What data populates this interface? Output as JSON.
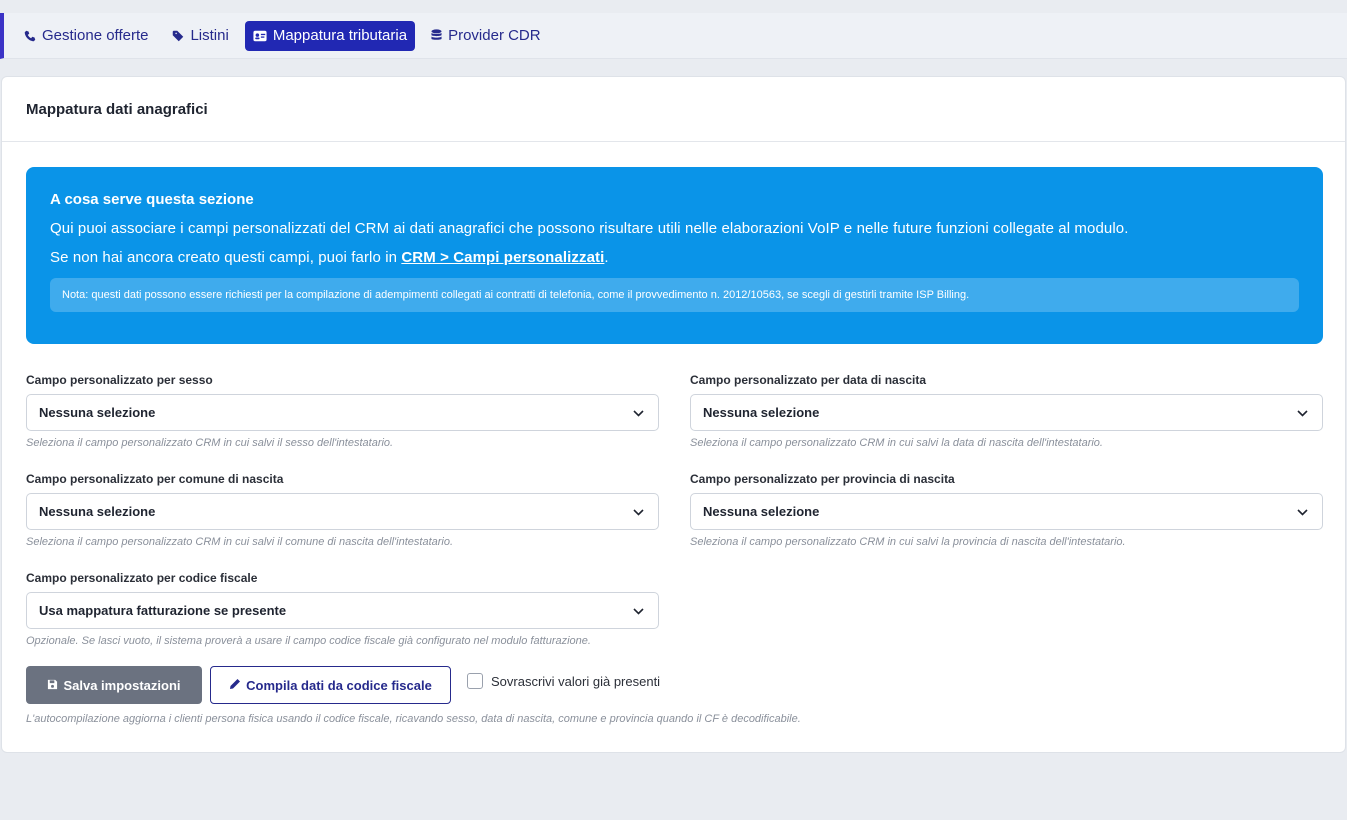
{
  "nav": {
    "tabs": [
      {
        "label": "Gestione offerte",
        "icon": "phone-icon",
        "active": false
      },
      {
        "label": "Listini",
        "icon": "tag-icon",
        "active": false
      },
      {
        "label": "Mappatura tributaria",
        "icon": "id-card-icon",
        "active": true
      },
      {
        "label": "Provider CDR",
        "icon": "database-icon",
        "active": false
      }
    ]
  },
  "card": {
    "title": "Mappatura dati anagrafici"
  },
  "info": {
    "title": "A cosa serve questa sezione",
    "line1": "Qui puoi associare i campi personalizzati del CRM ai dati anagrafici che possono risultare utili nelle elaborazioni VoIP e nelle future funzioni collegate al modulo.",
    "line2_prefix": "Se non hai ancora creato questi campi, puoi farlo in ",
    "line2_link": "CRM > Campi personalizzati",
    "line2_suffix": ".",
    "note": "Nota: questi dati possono essere richiesti per la compilazione di adempimenti collegati ai contratti di telefonia, come il provvedimento n. 2012/10563, se scegli di gestirli tramite ISP Billing."
  },
  "fields": {
    "sesso": {
      "label": "Campo personalizzato per sesso",
      "value": "Nessuna selezione",
      "help": "Seleziona il campo personalizzato CRM in cui salvi il sesso dell'intestatario."
    },
    "data_nascita": {
      "label": "Campo personalizzato per data di nascita",
      "value": "Nessuna selezione",
      "help": "Seleziona il campo personalizzato CRM in cui salvi la data di nascita dell'intestatario."
    },
    "comune_nascita": {
      "label": "Campo personalizzato per comune di nascita",
      "value": "Nessuna selezione",
      "help": "Seleziona il campo personalizzato CRM in cui salvi il comune di nascita dell'intestatario."
    },
    "provincia_nascita": {
      "label": "Campo personalizzato per provincia di nascita",
      "value": "Nessuna selezione",
      "help": "Seleziona il campo personalizzato CRM in cui salvi la provincia di nascita dell'intestatario."
    },
    "codice_fiscale": {
      "label": "Campo personalizzato per codice fiscale",
      "value": "Usa mappatura fatturazione se presente",
      "help": "Opzionale. Se lasci vuoto, il sistema proverà a usare il campo codice fiscale già configurato nel modulo fatturazione."
    }
  },
  "actions": {
    "save_label": "Salva impostazioni",
    "compile_label": "Compila dati da codice fiscale",
    "overwrite_label": "Sovrascrivi valori già presenti",
    "overwrite_checked": false,
    "footer_help": "L'autocompilazione aggiorna i clienti persona fisica usando il codice fiscale, ricavando sesso, data di nascita, comune e provincia quando il CF è decodificabile."
  },
  "colors": {
    "accent": "#2128b3",
    "info_bg": "#0a94e8",
    "save_bg": "#6b7280"
  }
}
